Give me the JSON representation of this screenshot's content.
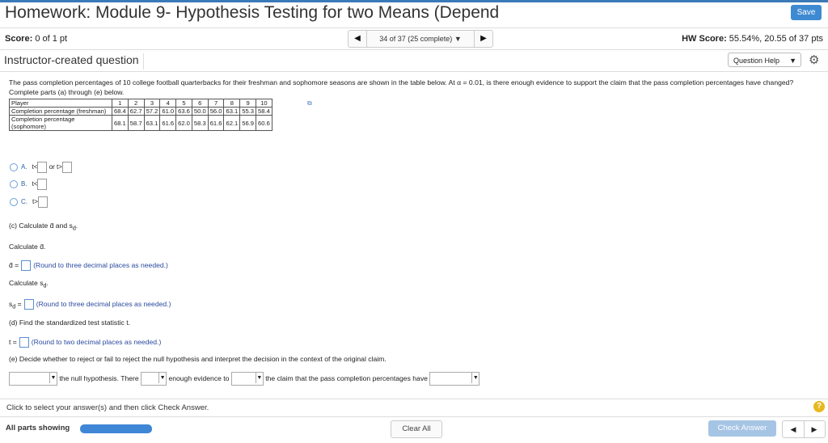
{
  "header": {
    "title": "Homework: Module 9- Hypothesis Testing for two Means (Depend",
    "save_label": "Save",
    "score_label": "Score:",
    "score_value": "0 of 1 pt",
    "nav_text": "34 of 37 (25 complete)",
    "hw_score_label": "HW Score:",
    "hw_score_value": "55.54%, 20.55 of 37 pts"
  },
  "subheader": {
    "instructor_label": "Instructor-created question",
    "question_help_label": "Question Help"
  },
  "question": {
    "text": "The pass completion percentages of 10 college football quarterbacks for their freshman and sophomore seasons are shown in the table below. At α = 0.01, is there enough evidence to support the claim that the pass completion percentages have changed? Complete parts (a) through (e) below.",
    "table": {
      "header_label": "Player",
      "players": [
        "1",
        "2",
        "3",
        "4",
        "5",
        "6",
        "7",
        "8",
        "9",
        "10"
      ],
      "rows": [
        {
          "label": "Completion percentage (freshman)",
          "values": [
            "68.4",
            "62.7",
            "57.2",
            "61.0",
            "63.6",
            "50.0",
            "56.0",
            "63.1",
            "55.3",
            "58.4"
          ]
        },
        {
          "label": "Completion percentage (sophomore)",
          "values": [
            "68.1",
            "58.7",
            "63.1",
            "61.6",
            "62.0",
            "58.3",
            "61.6",
            "62.1",
            "56.9",
            "60.6"
          ]
        }
      ]
    }
  },
  "options": [
    {
      "letter": "A.",
      "text1": "t<",
      "text2": "or t>"
    },
    {
      "letter": "B.",
      "text1": "t<"
    },
    {
      "letter": "C.",
      "text1": "t>"
    }
  ],
  "parts": {
    "c_heading": "(c) Calculate d̄ and s",
    "c_sub": "d",
    "calc_d": "Calculate d̄.",
    "d_label": "d̄ =",
    "d_hint": "(Round to three decimal places as needed.)",
    "calc_sd": "Calculate s",
    "calc_sd_sub": "d",
    "sd_label": "s",
    "sd_sub": "d",
    "sd_eq": "=",
    "sd_hint": "(Round to three decimal places as needed.)",
    "d_heading": "(d) Find the standardized test statistic t.",
    "t_label": "t =",
    "t_hint": "(Round to two decimal places as needed.)",
    "e_heading": "(e) Decide whether to reject or fail to reject the null hypothesis and interpret the decision in the context of the original claim.",
    "e_text1": "the null hypothesis. There",
    "e_text2": "enough evidence to",
    "e_text3": "the claim that the pass completion percentages have"
  },
  "footer": {
    "instruction": "Click to select your answer(s) and then click Check Answer.",
    "all_parts": "All parts showing",
    "progress": 1.0,
    "clear_all": "Clear All",
    "check_answer": "Check Answer"
  }
}
